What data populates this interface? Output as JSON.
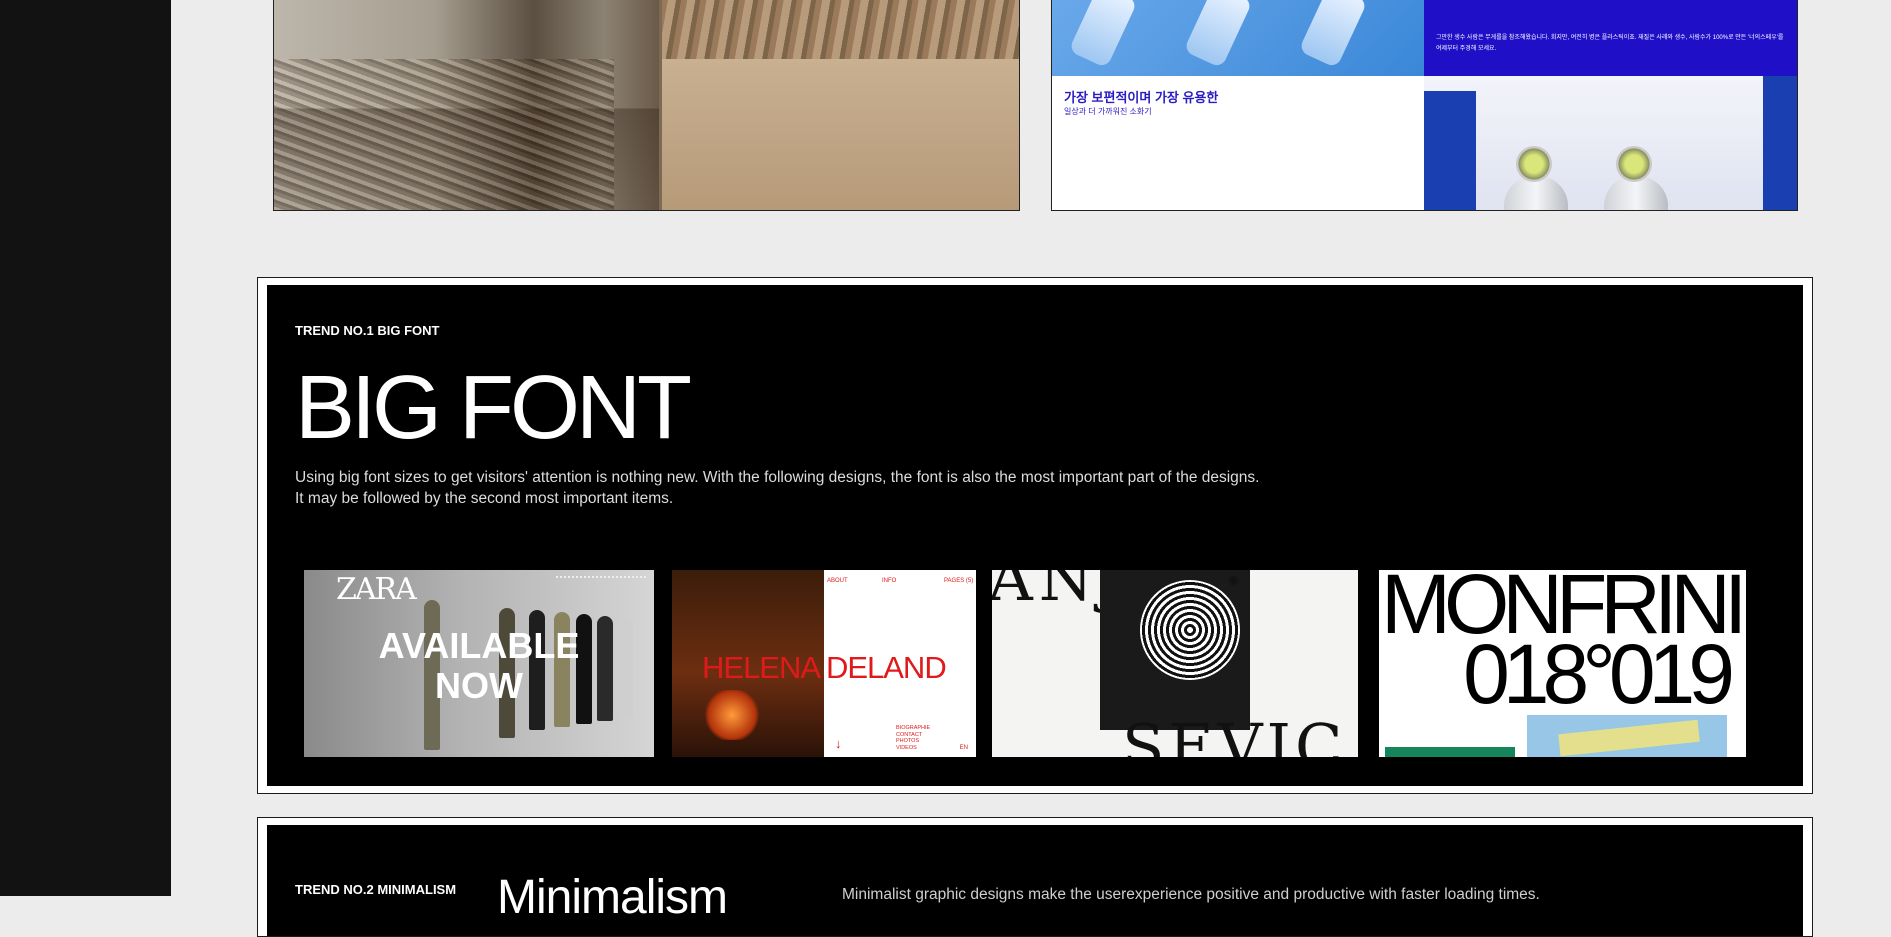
{
  "colors": {
    "page_bg": "#ececec",
    "sidebar_bg": "#121212",
    "trend_bg": "#000000",
    "korean_blue": "#1f10c8",
    "helena_red": "#e0191b",
    "monfrini_green": "#15865b"
  },
  "top_cards": {
    "korean": {
      "panel_text": "그만한 생수 사람은 무게를을 참조해왔습니다. 회지만, 여전히 병은 플라스틱이죠. 재질은 사래와 생수, 사람수가 100%로 만든 '너의스페우'를 여제부터 주경해 모세요.",
      "title": "가장 보편적이며 가장 유용한",
      "subtitle": "일상과 더 가까워진 소화기"
    }
  },
  "trend1": {
    "label": "TREND NO.1 BIG FONT",
    "heading": "BIG FONT",
    "desc_line1": "Using big font sizes to get visitors' attention is nothing new. With the following designs, the font is also the most important part of the designs.",
    "desc_line2": "It may be followed by the second most important items.",
    "examples": {
      "zara": {
        "logo": "ZARA",
        "line1": "AVAILABLE",
        "line2": "NOW"
      },
      "helena": {
        "name": "HELENA DELAND",
        "nav1": "ABOUT",
        "nav2": "INFO",
        "nav3": "PAGES (5)",
        "menu": "BIOGRAPHIE\nCONTACT\nPHOTOS\nVIDEOS",
        "lang": "EN"
      },
      "anja": {
        "top_word": "ANJA",
        "bottom_word": "SEVIC"
      },
      "monfrini": {
        "word": "MONFRINI",
        "numbers": "018°019"
      }
    }
  },
  "trend2": {
    "label": "TREND NO.2 MINIMALISM",
    "heading": "Minimalism",
    "desc": "Minimalist graphic designs make the userexperience positive and productive with faster loading times."
  }
}
